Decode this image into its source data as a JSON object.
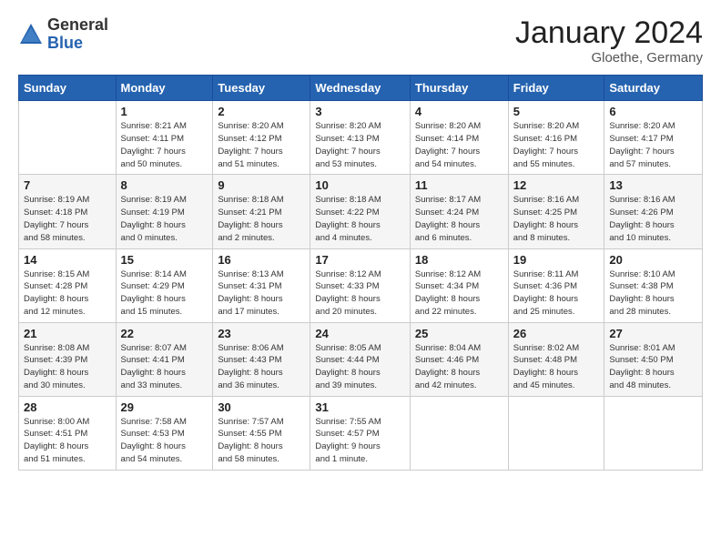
{
  "header": {
    "logo_general": "General",
    "logo_blue": "Blue",
    "month_title": "January 2024",
    "location": "Gloethe, Germany"
  },
  "weekdays": [
    "Sunday",
    "Monday",
    "Tuesday",
    "Wednesday",
    "Thursday",
    "Friday",
    "Saturday"
  ],
  "weeks": [
    [
      {
        "day": "",
        "info": ""
      },
      {
        "day": "1",
        "info": "Sunrise: 8:21 AM\nSunset: 4:11 PM\nDaylight: 7 hours\nand 50 minutes."
      },
      {
        "day": "2",
        "info": "Sunrise: 8:20 AM\nSunset: 4:12 PM\nDaylight: 7 hours\nand 51 minutes."
      },
      {
        "day": "3",
        "info": "Sunrise: 8:20 AM\nSunset: 4:13 PM\nDaylight: 7 hours\nand 53 minutes."
      },
      {
        "day": "4",
        "info": "Sunrise: 8:20 AM\nSunset: 4:14 PM\nDaylight: 7 hours\nand 54 minutes."
      },
      {
        "day": "5",
        "info": "Sunrise: 8:20 AM\nSunset: 4:16 PM\nDaylight: 7 hours\nand 55 minutes."
      },
      {
        "day": "6",
        "info": "Sunrise: 8:20 AM\nSunset: 4:17 PM\nDaylight: 7 hours\nand 57 minutes."
      }
    ],
    [
      {
        "day": "7",
        "info": "Sunrise: 8:19 AM\nSunset: 4:18 PM\nDaylight: 7 hours\nand 58 minutes."
      },
      {
        "day": "8",
        "info": "Sunrise: 8:19 AM\nSunset: 4:19 PM\nDaylight: 8 hours\nand 0 minutes."
      },
      {
        "day": "9",
        "info": "Sunrise: 8:18 AM\nSunset: 4:21 PM\nDaylight: 8 hours\nand 2 minutes."
      },
      {
        "day": "10",
        "info": "Sunrise: 8:18 AM\nSunset: 4:22 PM\nDaylight: 8 hours\nand 4 minutes."
      },
      {
        "day": "11",
        "info": "Sunrise: 8:17 AM\nSunset: 4:24 PM\nDaylight: 8 hours\nand 6 minutes."
      },
      {
        "day": "12",
        "info": "Sunrise: 8:16 AM\nSunset: 4:25 PM\nDaylight: 8 hours\nand 8 minutes."
      },
      {
        "day": "13",
        "info": "Sunrise: 8:16 AM\nSunset: 4:26 PM\nDaylight: 8 hours\nand 10 minutes."
      }
    ],
    [
      {
        "day": "14",
        "info": "Sunrise: 8:15 AM\nSunset: 4:28 PM\nDaylight: 8 hours\nand 12 minutes."
      },
      {
        "day": "15",
        "info": "Sunrise: 8:14 AM\nSunset: 4:29 PM\nDaylight: 8 hours\nand 15 minutes."
      },
      {
        "day": "16",
        "info": "Sunrise: 8:13 AM\nSunset: 4:31 PM\nDaylight: 8 hours\nand 17 minutes."
      },
      {
        "day": "17",
        "info": "Sunrise: 8:12 AM\nSunset: 4:33 PM\nDaylight: 8 hours\nand 20 minutes."
      },
      {
        "day": "18",
        "info": "Sunrise: 8:12 AM\nSunset: 4:34 PM\nDaylight: 8 hours\nand 22 minutes."
      },
      {
        "day": "19",
        "info": "Sunrise: 8:11 AM\nSunset: 4:36 PM\nDaylight: 8 hours\nand 25 minutes."
      },
      {
        "day": "20",
        "info": "Sunrise: 8:10 AM\nSunset: 4:38 PM\nDaylight: 8 hours\nand 28 minutes."
      }
    ],
    [
      {
        "day": "21",
        "info": "Sunrise: 8:08 AM\nSunset: 4:39 PM\nDaylight: 8 hours\nand 30 minutes."
      },
      {
        "day": "22",
        "info": "Sunrise: 8:07 AM\nSunset: 4:41 PM\nDaylight: 8 hours\nand 33 minutes."
      },
      {
        "day": "23",
        "info": "Sunrise: 8:06 AM\nSunset: 4:43 PM\nDaylight: 8 hours\nand 36 minutes."
      },
      {
        "day": "24",
        "info": "Sunrise: 8:05 AM\nSunset: 4:44 PM\nDaylight: 8 hours\nand 39 minutes."
      },
      {
        "day": "25",
        "info": "Sunrise: 8:04 AM\nSunset: 4:46 PM\nDaylight: 8 hours\nand 42 minutes."
      },
      {
        "day": "26",
        "info": "Sunrise: 8:02 AM\nSunset: 4:48 PM\nDaylight: 8 hours\nand 45 minutes."
      },
      {
        "day": "27",
        "info": "Sunrise: 8:01 AM\nSunset: 4:50 PM\nDaylight: 8 hours\nand 48 minutes."
      }
    ],
    [
      {
        "day": "28",
        "info": "Sunrise: 8:00 AM\nSunset: 4:51 PM\nDaylight: 8 hours\nand 51 minutes."
      },
      {
        "day": "29",
        "info": "Sunrise: 7:58 AM\nSunset: 4:53 PM\nDaylight: 8 hours\nand 54 minutes."
      },
      {
        "day": "30",
        "info": "Sunrise: 7:57 AM\nSunset: 4:55 PM\nDaylight: 8 hours\nand 58 minutes."
      },
      {
        "day": "31",
        "info": "Sunrise: 7:55 AM\nSunset: 4:57 PM\nDaylight: 9 hours\nand 1 minute."
      },
      {
        "day": "",
        "info": ""
      },
      {
        "day": "",
        "info": ""
      },
      {
        "day": "",
        "info": ""
      }
    ]
  ]
}
